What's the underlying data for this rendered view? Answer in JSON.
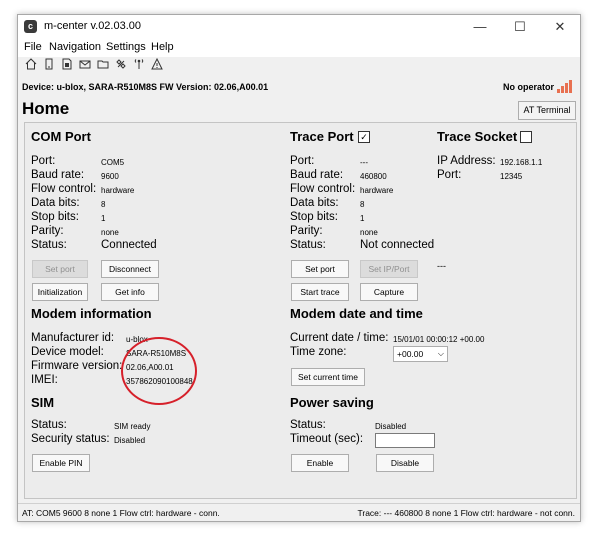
{
  "window": {
    "app_icon": "c",
    "title": "m-center v.02.03.00",
    "minimize": "—",
    "maximize": "☐",
    "close": "✕"
  },
  "menu": [
    "File",
    "Navigation",
    "Settings",
    "Help"
  ],
  "toolbar_icons": [
    "home-icon",
    "phone-icon",
    "sim-icon",
    "mail-icon",
    "folder-icon",
    "satellite-icon",
    "antenna-icon",
    "warning-icon"
  ],
  "device_bar": {
    "device_info": "Device: u-blox, SARA-R510M8S   FW Version: 02.06,A00.01",
    "operator": "No operator"
  },
  "page": {
    "title": "Home",
    "at_terminal": "AT Terminal"
  },
  "com_port": {
    "title": "COM Port",
    "rows": [
      {
        "label": "Port:",
        "value": "COM5"
      },
      {
        "label": "Baud rate:",
        "value": "9600"
      },
      {
        "label": "Flow control:",
        "value": "hardware"
      },
      {
        "label": "Data bits:",
        "value": "8"
      },
      {
        "label": "Stop bits:",
        "value": "1"
      },
      {
        "label": "Parity:",
        "value": "none"
      },
      {
        "label": "Status:",
        "value": "Connected"
      }
    ],
    "set_port": "Set port",
    "disconnect": "Disconnect",
    "initialization": "Initialization",
    "get_info": "Get info"
  },
  "trace_port": {
    "title": "Trace Port",
    "checkbox_mark": "✓",
    "rows": [
      {
        "label": "Port:",
        "value": "---"
      },
      {
        "label": "Baud rate:",
        "value": "460800"
      },
      {
        "label": "Flow control:",
        "value": "hardware"
      },
      {
        "label": "Data bits:",
        "value": "8"
      },
      {
        "label": "Stop bits:",
        "value": "1"
      },
      {
        "label": "Parity:",
        "value": "none"
      },
      {
        "label": "Status:",
        "value": "Not connected"
      }
    ],
    "set_port": "Set port",
    "set_ip_port": "Set IP/Port",
    "ip_status": "---",
    "start_trace": "Start trace",
    "capture": "Capture"
  },
  "trace_socket": {
    "title": "Trace Socket",
    "ip_label": "IP Address:",
    "ip_value": "192.168.1.1",
    "port_label": "Port:",
    "port_value": "12345"
  },
  "modem_info": {
    "title": "Modem information",
    "rows": [
      {
        "label": "Manufacturer id:",
        "value": "u-blox"
      },
      {
        "label": "Device model:",
        "value": "SARA-R510M8S"
      },
      {
        "label": "Firmware version:",
        "value": "02.06,A00.01"
      },
      {
        "label": "IMEI:",
        "value": "357862090100848"
      }
    ]
  },
  "modem_datetime": {
    "title": "Modem date and time",
    "datetime_label": "Current date / time:",
    "datetime_value": "15/01/01 00:00:12 +00.00",
    "timezone_label": "Time zone:",
    "timezone_value": "+00.00",
    "set_time": "Set current time"
  },
  "sim": {
    "title": "SIM",
    "status_label": "Status:",
    "status_value": "SIM ready",
    "security_label": "Security status:",
    "security_value": "Disabled",
    "enable_pin": "Enable PIN"
  },
  "power_saving": {
    "title": "Power saving",
    "status_label": "Status:",
    "status_value": "Disabled",
    "timeout_label": "Timeout (sec):",
    "timeout_value": "",
    "enable": "Enable",
    "disable": "Disable"
  },
  "statusbar": {
    "left": "AT: COM5 9600 8 none 1 Flow ctrl: hardware - conn.",
    "right": "Trace: --- 460800 8 none 1 Flow ctrl: hardware - not conn."
  },
  "colors": {
    "annotation_circle": "#d6202a",
    "signal": "#e87050"
  }
}
